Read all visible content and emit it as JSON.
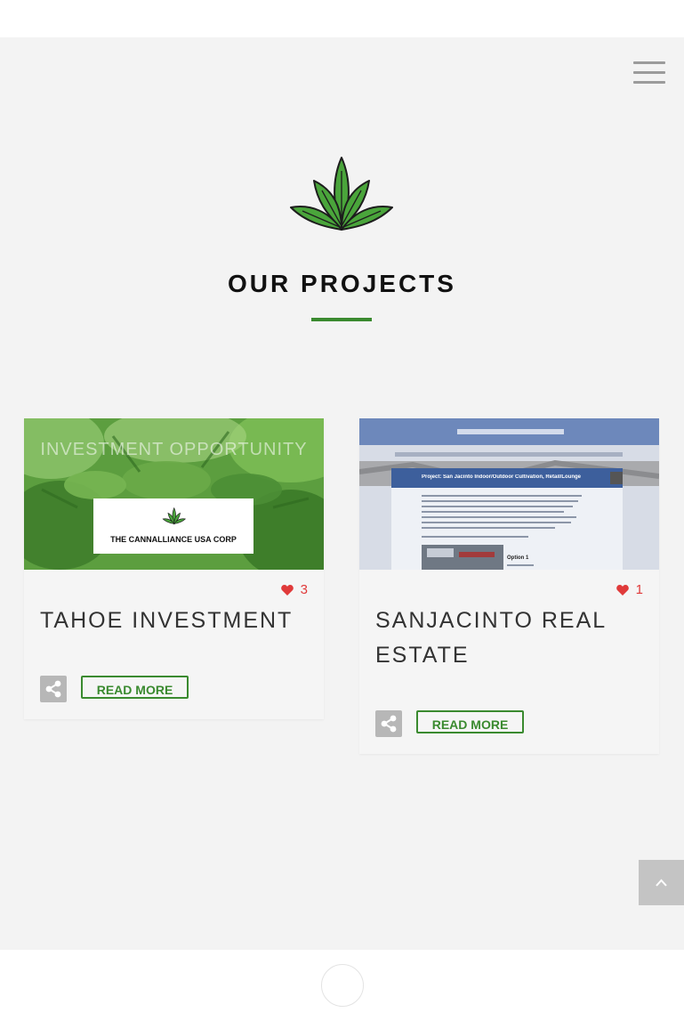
{
  "header": {
    "menu_icon": "hamburger-menu-icon"
  },
  "section": {
    "logo_icon": "cannabis-leaf-icon",
    "title": "OUR PROJECTS",
    "accent_color": "#3a8a2f"
  },
  "projects": [
    {
      "image": {
        "overlay_text": "INVESTMENT OPPORTUNITY",
        "company_name": "THE CANNALLIANCE USA CORP"
      },
      "likes": "3",
      "title": "TAHOE INVESTMENT",
      "read_more_label": "READ MORE",
      "share_icon": "share-icon",
      "like_icon": "heart-icon"
    },
    {
      "image": {
        "header_text": "Project: San Jacinto Indoor/Outdoor Cultivation, Retail/Lounge",
        "option_label": "Option 1"
      },
      "likes": "1",
      "title": "SANJACINTO REAL ESTATE",
      "read_more_label": "READ MORE",
      "share_icon": "share-icon",
      "like_icon": "heart-icon"
    }
  ],
  "back_to_top_icon": "chevron-up-icon",
  "footer": {
    "icon": "circle-icon"
  }
}
